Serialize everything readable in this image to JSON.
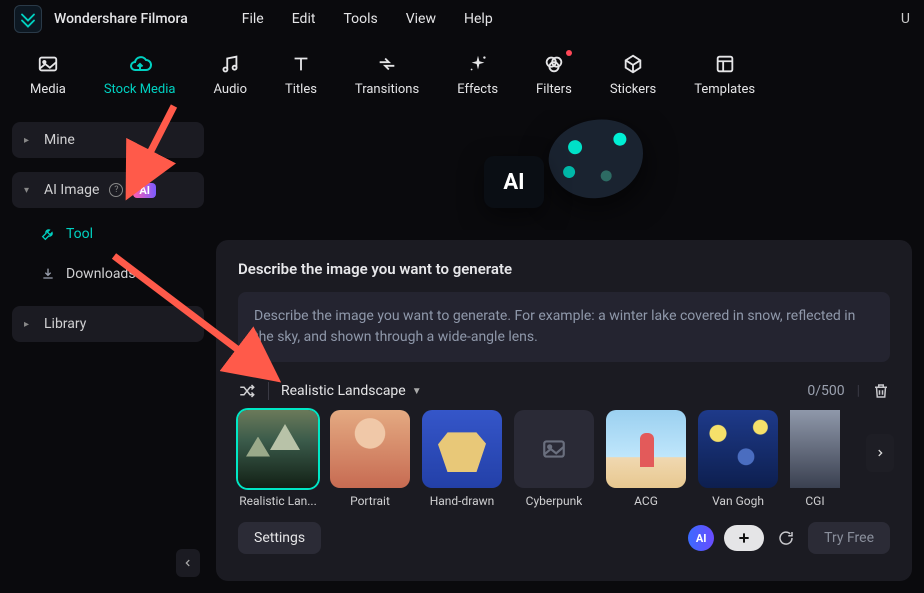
{
  "app": {
    "name": "Wondershare Filmora"
  },
  "menu": {
    "items": [
      "File",
      "Edit",
      "Tools",
      "View",
      "Help"
    ],
    "right": "U"
  },
  "toolbar": {
    "items": [
      {
        "label": "Media"
      },
      {
        "label": "Stock Media",
        "active": true
      },
      {
        "label": "Audio"
      },
      {
        "label": "Titles"
      },
      {
        "label": "Transitions"
      },
      {
        "label": "Effects"
      },
      {
        "label": "Filters",
        "badge": true
      },
      {
        "label": "Stickers"
      },
      {
        "label": "Templates"
      }
    ]
  },
  "sidebar": {
    "mine": "Mine",
    "ai_image": "AI Image",
    "ai_badge": "AI",
    "tool": "Tool",
    "downloads": "Downloads",
    "library": "Library"
  },
  "panel": {
    "title": "Describe the image you want to generate",
    "placeholder": "Describe the image you want to generate. For example: a winter lake covered in snow, reflected in the sky, and shown through a wide-angle lens.",
    "selected_style": "Realistic Landscape",
    "counter": "0/500",
    "styles": [
      {
        "label": "Realistic Lan..."
      },
      {
        "label": "Portrait"
      },
      {
        "label": "Hand-drawn"
      },
      {
        "label": "Cyberpunk"
      },
      {
        "label": "ACG"
      },
      {
        "label": "Van Gogh"
      },
      {
        "label": "CGI"
      }
    ],
    "settings": "Settings",
    "ai_chip": "AI",
    "try_free": "Try Free"
  }
}
